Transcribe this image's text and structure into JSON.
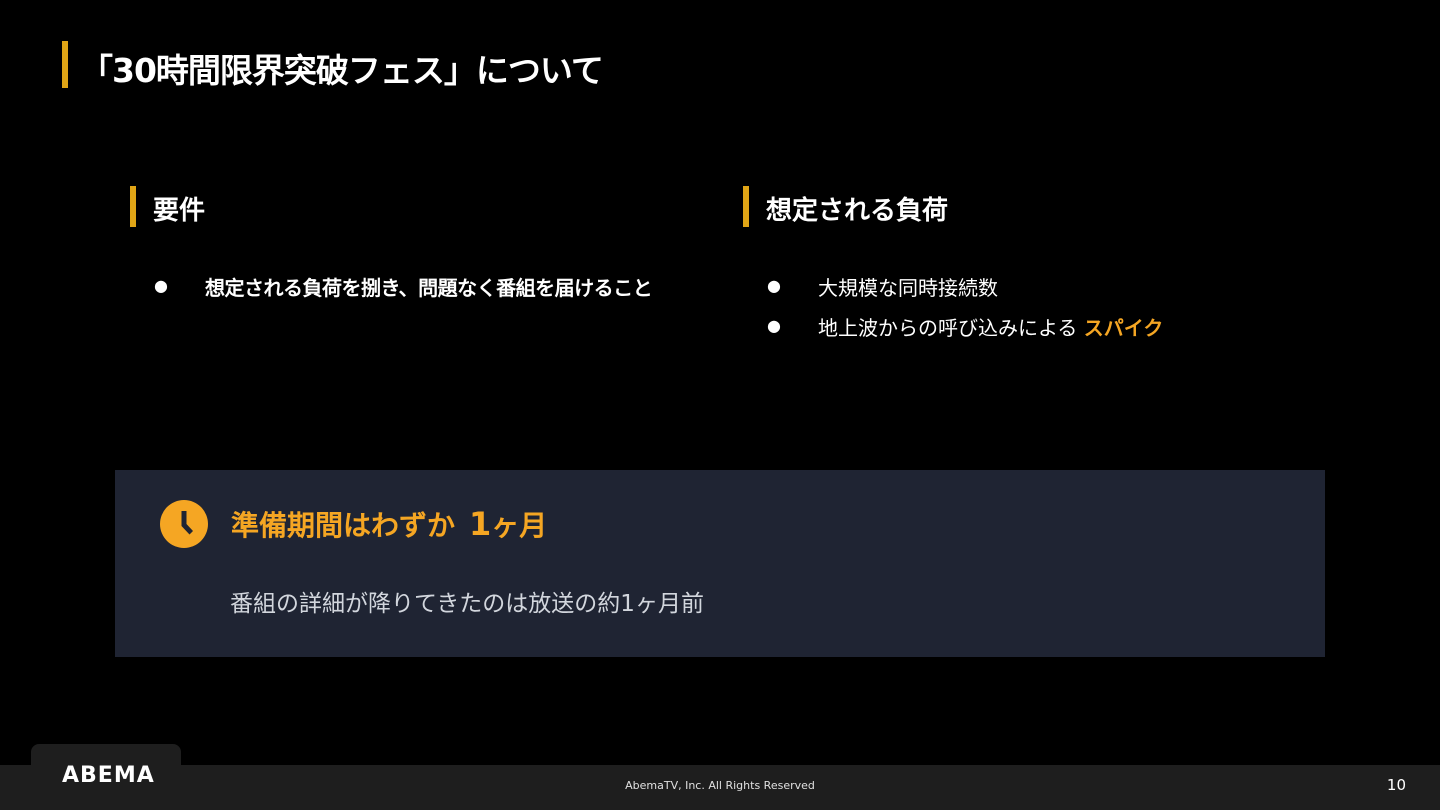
{
  "slide": {
    "title": "「30時間限界突破フェス」について",
    "page_number": "10"
  },
  "requirements": {
    "heading": "要件",
    "bullet_glyph": "●",
    "items": [
      "想定される負荷を捌き、問題なく番組を届けること"
    ]
  },
  "expected_load": {
    "heading": "想定される負荷",
    "bullet_glyph": "●",
    "items": [
      {
        "text": "大規模な同時接続数",
        "highlight": ""
      },
      {
        "text": "地上波からの呼び込みによる",
        "highlight": "スパイク"
      }
    ]
  },
  "info_box": {
    "icon": "clock-icon",
    "heading_text": "準備期間はわずか",
    "heading_number": "1",
    "heading_unit": "ヶ月",
    "body": "番組の詳細が降りてきたのは放送の約1ヶ月前"
  },
  "footer": {
    "logo_text": "ABEMA",
    "copyright": "AbemaTV, Inc. All Rights Reserved"
  },
  "colors": {
    "accent": "#f5a623",
    "bar": "#e0a516",
    "box_bg": "#1f2433",
    "footer_bg": "#1e1e1e"
  }
}
